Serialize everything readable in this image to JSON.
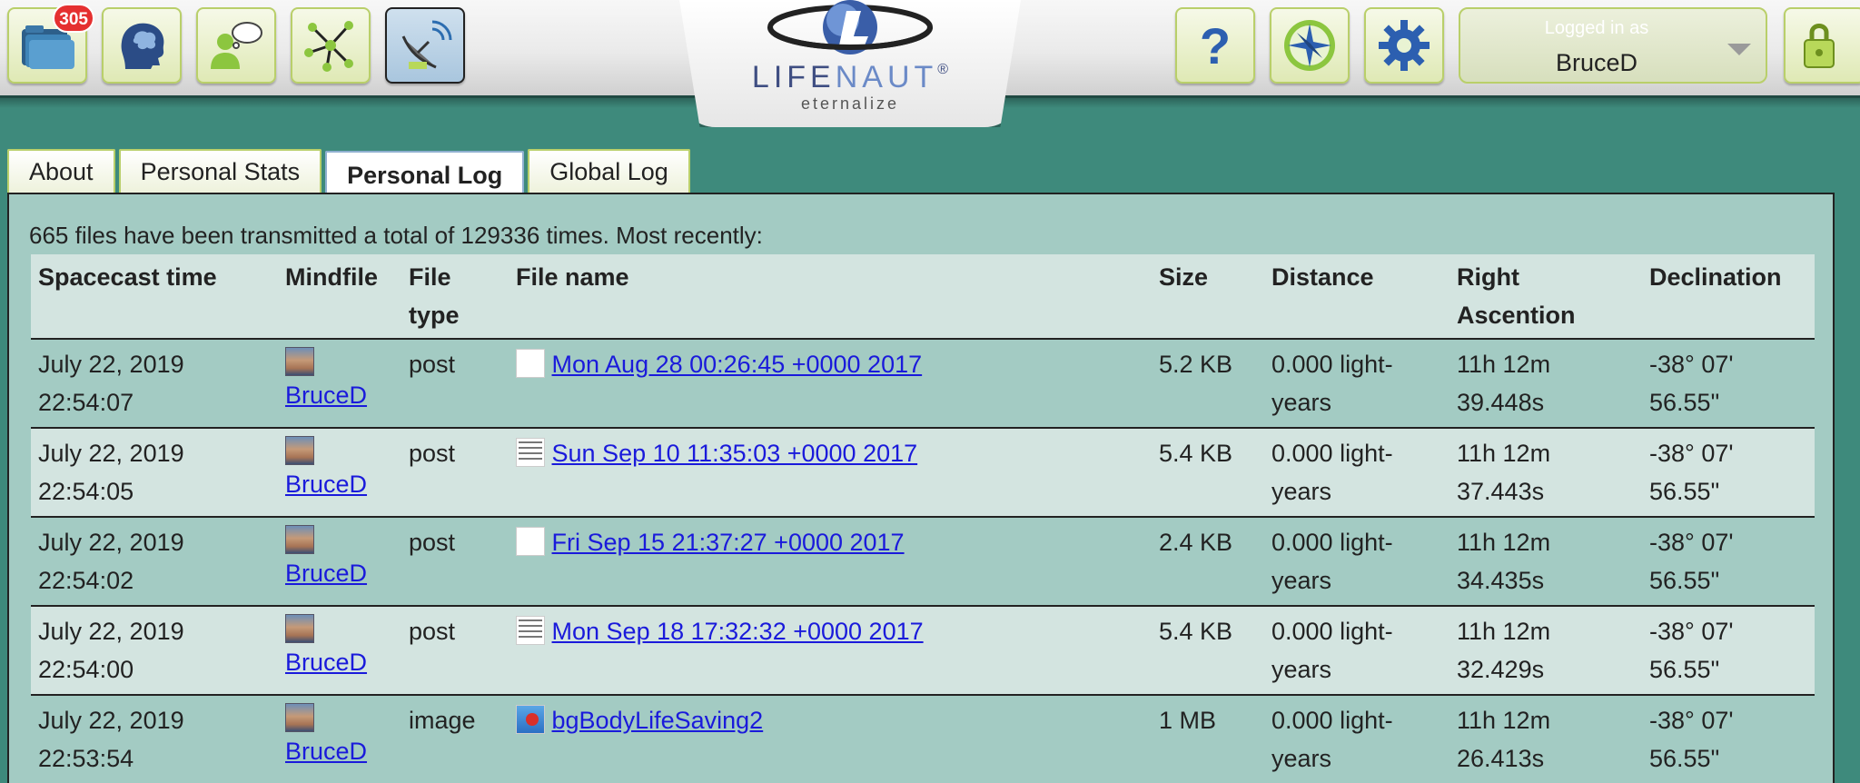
{
  "toolbar": {
    "mindfiles_badge": "305",
    "icons": [
      "folder-stack-icon",
      "brain-head-icon",
      "thinking-person-icon",
      "network-icon",
      "satellite-dish-icon",
      "help-icon",
      "compass-icon",
      "gear-icon",
      "lock-keys-icon"
    ]
  },
  "logo": {
    "word_left": "LIFE",
    "word_right": "NAUT",
    "registered": "®",
    "tagline": "eternalize",
    "colors": {
      "dark": "#3f4e82",
      "light": "#6b8ac7"
    }
  },
  "user": {
    "label": "Logged in as",
    "name": "BruceD"
  },
  "tabs": [
    {
      "label": "About",
      "active": false
    },
    {
      "label": "Personal Stats",
      "active": false
    },
    {
      "label": "Personal Log",
      "active": true
    },
    {
      "label": "Global Log",
      "active": false
    }
  ],
  "log": {
    "summary": "665 files have been transmitted a total of 129336 times. Most recently:",
    "columns": {
      "time": "Spacecast time",
      "mindfile": "Mindfile",
      "type": "File type",
      "name": "File name",
      "size": "Size",
      "distance": "Distance",
      "ra": "Right Ascention",
      "dec": "Declination"
    },
    "rows": [
      {
        "date": "July 22, 2019",
        "time": "22:54:07",
        "user": "BruceD",
        "type": "post",
        "name": "Mon Aug 28 00:26:45 +0000 2017",
        "size": "5.2 KB",
        "distance": "0.000 light-years",
        "ra_h": "11h 12m",
        "ra_s": "39.448s",
        "dec_d": "-38° 07'",
        "dec_s": "56.55\""
      },
      {
        "date": "July 22, 2019",
        "time": "22:54:05",
        "user": "BruceD",
        "type": "post",
        "name": "Sun Sep 10 11:35:03 +0000 2017",
        "size": "5.4 KB",
        "distance": "0.000 light-years",
        "ra_h": "11h 12m",
        "ra_s": "37.443s",
        "dec_d": "-38° 07'",
        "dec_s": "56.55\""
      },
      {
        "date": "July 22, 2019",
        "time": "22:54:02",
        "user": "BruceD",
        "type": "post",
        "name": "Fri Sep 15 21:37:27 +0000 2017",
        "size": "2.4 KB",
        "distance": "0.000 light-years",
        "ra_h": "11h 12m",
        "ra_s": "34.435s",
        "dec_d": "-38° 07'",
        "dec_s": "56.55\""
      },
      {
        "date": "July 22, 2019",
        "time": "22:54:00",
        "user": "BruceD",
        "type": "post",
        "name": "Mon Sep 18 17:32:32 +0000 2017",
        "size": "5.4 KB",
        "distance": "0.000 light-years",
        "ra_h": "11h 12m",
        "ra_s": "32.429s",
        "dec_d": "-38° 07'",
        "dec_s": "56.55\""
      },
      {
        "date": "July 22, 2019",
        "time": "22:53:54",
        "user": "BruceD",
        "type": "image",
        "name": "bgBodyLifeSaving2",
        "size": "1 MB",
        "distance": "0.000 light-years",
        "ra_h": "11h 12m",
        "ra_s": "26.413s",
        "dec_d": "-38° 07'",
        "dec_s": "56.55\""
      }
    ]
  }
}
